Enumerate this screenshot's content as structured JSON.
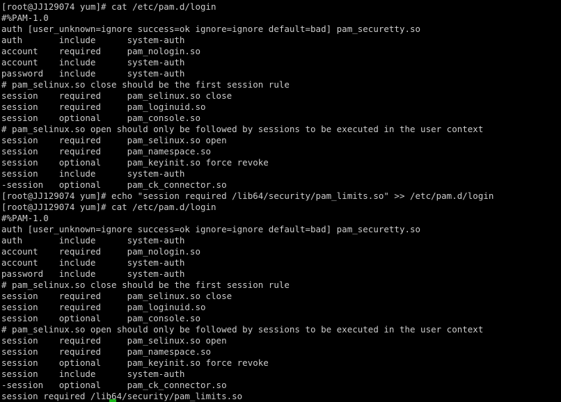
{
  "terminal": {
    "title": "root@JJ129074:/yum",
    "colors": {
      "background": "#000000",
      "foreground": "#cccccc",
      "cursor": "#18b218"
    },
    "prompt": "[root@JJ129074 yum]#",
    "hostname": "JJ129074",
    "user": "root",
    "cwd": "yum",
    "cursor": {
      "column": 22,
      "row": 36,
      "visible": true
    },
    "lines": [
      "[root@JJ129074 yum]# cat /etc/pam.d/login",
      "#%PAM-1.0",
      "auth [user_unknown=ignore success=ok ignore=ignore default=bad] pam_securetty.so",
      "auth       include      system-auth",
      "account    required     pam_nologin.so",
      "account    include      system-auth",
      "password   include      system-auth",
      "# pam_selinux.so close should be the first session rule",
      "session    required     pam_selinux.so close",
      "session    required     pam_loginuid.so",
      "session    optional     pam_console.so",
      "# pam_selinux.so open should only be followed by sessions to be executed in the user context",
      "session    required     pam_selinux.so open",
      "session    required     pam_namespace.so",
      "session    optional     pam_keyinit.so force revoke",
      "session    include      system-auth",
      "-session   optional     pam_ck_connector.so",
      "[root@JJ129074 yum]# echo \"session required /lib64/security/pam_limits.so\" >> /etc/pam.d/login",
      "[root@JJ129074 yum]# cat /etc/pam.d/login",
      "#%PAM-1.0",
      "auth [user_unknown=ignore success=ok ignore=ignore default=bad] pam_securetty.so",
      "auth       include      system-auth",
      "account    required     pam_nologin.so",
      "account    include      system-auth",
      "password   include      system-auth",
      "# pam_selinux.so close should be the first session rule",
      "session    required     pam_selinux.so close",
      "session    required     pam_loginuid.so",
      "session    optional     pam_console.so",
      "# pam_selinux.so open should only be followed by sessions to be executed in the user context",
      "session    required     pam_selinux.so open",
      "session    required     pam_namespace.so",
      "session    optional     pam_keyinit.so force revoke",
      "session    include      system-auth",
      "-session   optional     pam_ck_connector.so",
      "session required /lib64/security/pam_limits.so"
    ]
  }
}
